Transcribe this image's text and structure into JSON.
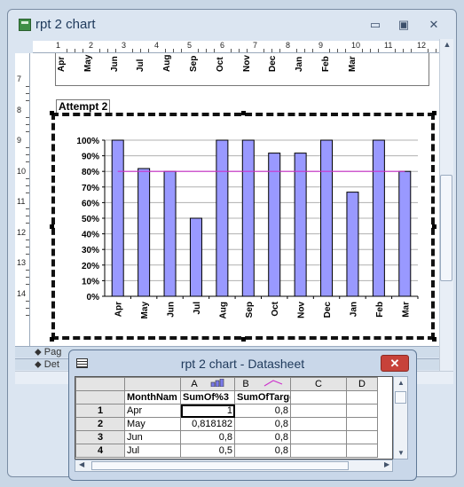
{
  "window": {
    "title": "rpt 2 chart",
    "minimize_glyph": "▭",
    "restore_glyph": "▣",
    "close_glyph": "✕"
  },
  "ruler": {
    "horizontal": [
      "1",
      "2",
      "3",
      "4",
      "5",
      "6",
      "7",
      "8",
      "9",
      "10",
      "11",
      "12"
    ],
    "vertical": [
      "7",
      "8",
      "9",
      "10",
      "11",
      "12",
      "13",
      "14"
    ]
  },
  "report": {
    "top_chart_months": [
      "Apr",
      "May",
      "Jun",
      "Jul",
      "Aug",
      "Sep",
      "Oct",
      "Nov",
      "Dec",
      "Jan",
      "Feb",
      "Mar"
    ],
    "label": "Attempt 2",
    "sections": [
      "Pag",
      "Det"
    ]
  },
  "chart_data": {
    "type": "bar",
    "categories": [
      "Apr",
      "May",
      "Jun",
      "Jul",
      "Aug",
      "Sep",
      "Oct",
      "Nov",
      "Dec",
      "Jan",
      "Feb",
      "Mar"
    ],
    "series": [
      {
        "values": [
          1.0,
          0.818182,
          0.8,
          0.5,
          1.0,
          1.0,
          0.917,
          0.917,
          1.0,
          0.667,
          1.0,
          0.8
        ],
        "color": "#9999ff"
      },
      {
        "values": [
          0.8,
          0.8,
          0.8,
          0.8,
          0.8,
          0.8,
          0.8,
          0.8,
          0.8,
          0.8,
          0.8,
          0.8
        ],
        "color": "#cc33cc",
        "type": "line"
      }
    ],
    "yticks": [
      "0%",
      "10%",
      "20%",
      "30%",
      "40%",
      "50%",
      "60%",
      "70%",
      "80%",
      "90%",
      "100%"
    ],
    "ylim": [
      0,
      1
    ],
    "grid": true
  },
  "datasheet": {
    "title": "rpt 2 chart - Datasheet",
    "close_glyph": "✕",
    "columns": [
      {
        "letter": "",
        "icon": ""
      },
      {
        "letter": "A",
        "icon": "bar-series-icon"
      },
      {
        "letter": "B",
        "icon": "line-series-icon"
      },
      {
        "letter": "C",
        "icon": ""
      },
      {
        "letter": "D",
        "icon": ""
      }
    ],
    "header_row": [
      "MonthNam",
      "SumOf%3",
      "SumOfTarget",
      "",
      ""
    ],
    "rows": [
      {
        "num": "1",
        "cells": [
          "Apr",
          "1",
          "0,8",
          "",
          ""
        ]
      },
      {
        "num": "2",
        "cells": [
          "May",
          "0,818182",
          "0,8",
          "",
          ""
        ]
      },
      {
        "num": "3",
        "cells": [
          "Jun",
          "0,8",
          "0,8",
          "",
          ""
        ]
      },
      {
        "num": "4",
        "cells": [
          "Jul",
          "0,5",
          "0,8",
          "",
          ""
        ]
      }
    ]
  }
}
